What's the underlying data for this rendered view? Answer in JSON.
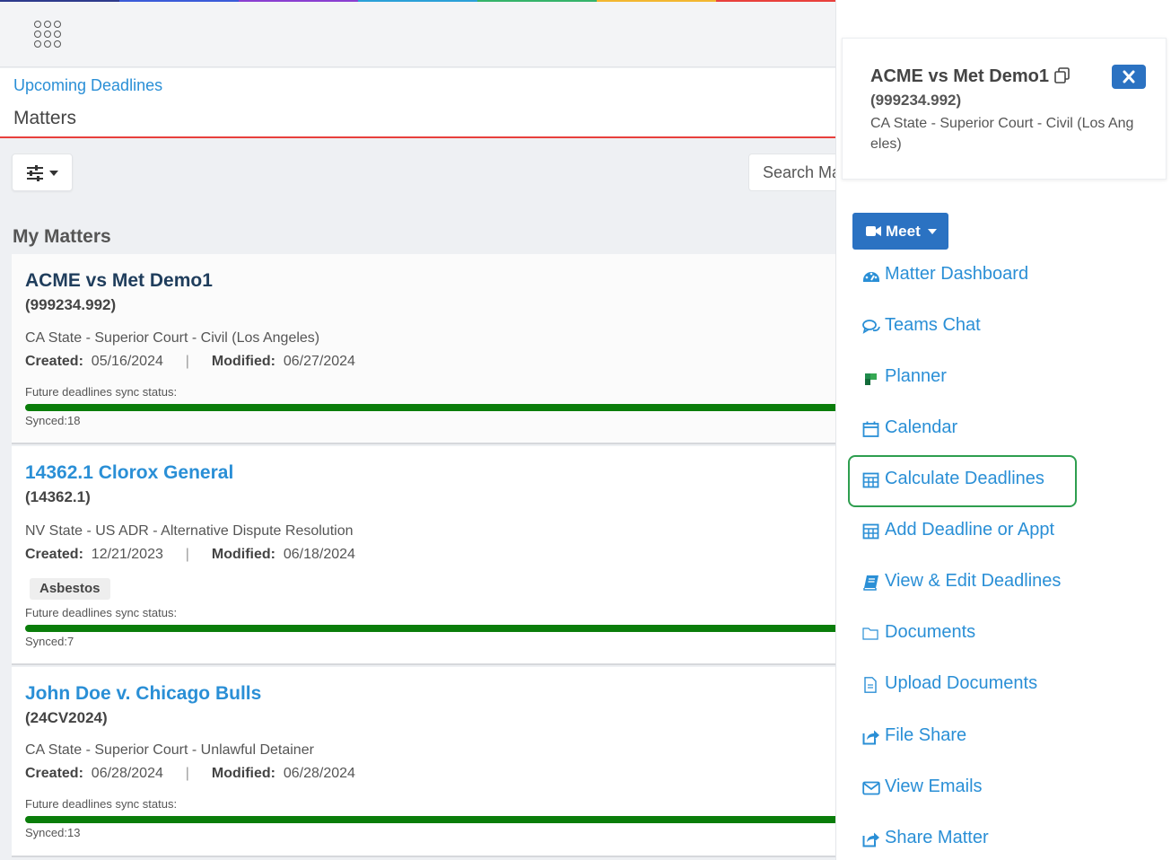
{
  "nav": {
    "rainbow_colors": [
      "#2d3a8c",
      "#3a5bd9",
      "#8a3fd1",
      "#2aa0d8",
      "#34b36a",
      "#f2b630",
      "#e8403c"
    ]
  },
  "header": {
    "breadcrumb": "Upcoming Deadlines",
    "title": "Matters",
    "accent_color": "#e8403c"
  },
  "toolbar": {
    "search_placeholder": "Search Matters"
  },
  "list": {
    "section_title": "My Matters",
    "created_label": "Created:",
    "modified_label": "Modified:",
    "separator": "|",
    "sync_label": "Future deadlines sync status:",
    "matters": [
      {
        "title": "ACME vs Met Demo1",
        "number": "(999234.992)",
        "court": "CA State - Superior Court - Civil (Los Angeles)",
        "created": "05/16/2024",
        "modified": "06/27/2024",
        "tag": "",
        "synced": "Synced:18",
        "sync_progress": 1.0
      },
      {
        "title": "14362.1 Clorox General",
        "number": "(14362.1)",
        "court": "NV State - US ADR - Alternative Dispute Resolution",
        "created": "12/21/2023",
        "modified": "06/18/2024",
        "tag": "Asbestos",
        "synced": "Synced:7",
        "sync_progress": 1.0
      },
      {
        "title": "John Doe v. Chicago Bulls",
        "number": "(24CV2024)",
        "court": "CA State - Superior Court - Unlawful Detainer",
        "created": "06/28/2024",
        "modified": "06/28/2024",
        "tag": "",
        "synced": "Synced:13",
        "sync_progress": 1.0
      }
    ]
  },
  "panel": {
    "title": "ACME vs Met Demo1",
    "number": "(999234.992)",
    "court": "CA State - Superior Court - Civil (Los Angeles)",
    "meet_label": "Meet",
    "menu": [
      {
        "label": "Matter Dashboard",
        "icon": "dashboard-icon"
      },
      {
        "label": "Teams Chat",
        "icon": "chat-icon"
      },
      {
        "label": "Planner",
        "icon": "planner-icon"
      },
      {
        "label": "Calendar",
        "icon": "calendar-icon"
      },
      {
        "label": "Calculate Deadlines",
        "icon": "calculator-icon",
        "highlighted": true
      },
      {
        "label": "Add Deadline or Appt",
        "icon": "calculator-icon"
      },
      {
        "label": "View & Edit Deadlines",
        "icon": "book-icon"
      },
      {
        "label": "Documents",
        "icon": "folder-icon"
      },
      {
        "label": "Upload Documents",
        "icon": "file-icon"
      },
      {
        "label": "File Share",
        "icon": "share-icon"
      },
      {
        "label": "View Emails",
        "icon": "envelope-icon"
      },
      {
        "label": "Share Matter",
        "icon": "share-icon"
      }
    ],
    "highlight_color": "#2e9e4f"
  }
}
